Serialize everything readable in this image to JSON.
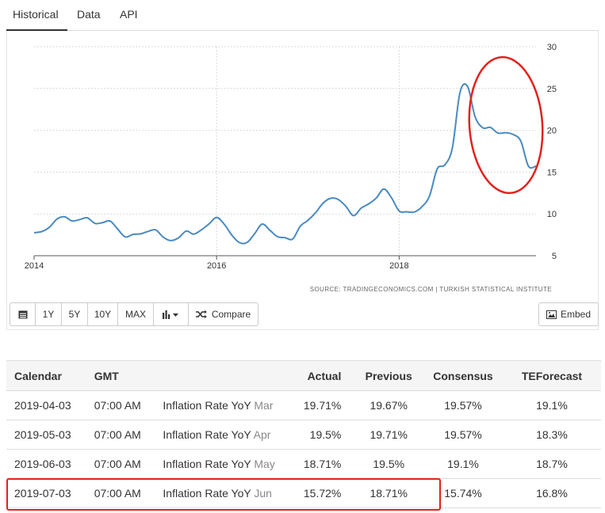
{
  "tabs": [
    "Historical",
    "Data",
    "API"
  ],
  "chart_data": {
    "type": "line",
    "x_ticks": [
      "2014",
      "2016",
      "2018"
    ],
    "y_ticks": [
      5,
      10,
      15,
      20,
      25,
      30
    ],
    "ylim": [
      5,
      30
    ],
    "xlim": [
      2014.0,
      2019.5
    ],
    "grid": true,
    "source_text": "SOURCE: TRADINGECONOMICS.COM  |  TURKISH STATISTICAL INSTITUTE",
    "series": [
      {
        "color": "#4a8ac0",
        "x": [
          2014.0,
          2014.083,
          2014.167,
          2014.25,
          2014.333,
          2014.417,
          2014.5,
          2014.583,
          2014.667,
          2014.75,
          2014.833,
          2014.917,
          2015.0,
          2015.083,
          2015.167,
          2015.25,
          2015.333,
          2015.417,
          2015.5,
          2015.583,
          2015.667,
          2015.75,
          2015.833,
          2015.917,
          2016.0,
          2016.083,
          2016.167,
          2016.25,
          2016.333,
          2016.417,
          2016.5,
          2016.583,
          2016.667,
          2016.75,
          2016.833,
          2016.917,
          2017.0,
          2017.083,
          2017.167,
          2017.25,
          2017.333,
          2017.417,
          2017.5,
          2017.583,
          2017.667,
          2017.75,
          2017.833,
          2017.917,
          2018.0,
          2018.083,
          2018.167,
          2018.25,
          2018.333,
          2018.417,
          2018.5,
          2018.583,
          2018.667,
          2018.75,
          2018.833,
          2018.917,
          2019.0,
          2019.083,
          2019.167,
          2019.25,
          2019.333,
          2019.417,
          2019.5
        ],
        "values": [
          7.75,
          7.89,
          8.39,
          9.38,
          9.66,
          9.16,
          9.32,
          9.54,
          8.86,
          8.96,
          9.15,
          8.17,
          7.24,
          7.55,
          7.61,
          7.91,
          8.09,
          7.2,
          6.81,
          7.14,
          7.95,
          7.58,
          8.1,
          8.81,
          9.58,
          8.78,
          7.46,
          6.57,
          6.58,
          7.64,
          8.79,
          8.05,
          7.28,
          7.16,
          7.0,
          8.53,
          9.22,
          10.13,
          11.29,
          11.87,
          11.72,
          10.9,
          9.79,
          10.68,
          11.2,
          11.9,
          12.98,
          11.92,
          10.35,
          10.26,
          10.23,
          10.85,
          12.15,
          15.39,
          15.85,
          17.9,
          24.52,
          25.24,
          21.62,
          20.3,
          20.35,
          19.67,
          19.71,
          19.5,
          18.71,
          15.72,
          15.72
        ]
      }
    ]
  },
  "toolbar": {
    "calendar_icon": "calendar-icon",
    "ranges": [
      "1Y",
      "5Y",
      "10Y",
      "MAX"
    ],
    "chart_type_icon": "bar-chart-icon",
    "compare_label": "Compare",
    "embed_label": "Embed"
  },
  "table": {
    "headers": [
      "Calendar",
      "GMT",
      "",
      "Actual",
      "Previous",
      "Consensus",
      "TEForecast"
    ],
    "rows": [
      {
        "date": "2019-04-03",
        "time": "07:00 AM",
        "event": "Inflation Rate YoY",
        "suffix": "Mar",
        "actual": "19.71%",
        "previous": "19.67%",
        "consensus": "19.57%",
        "forecast": "19.1%"
      },
      {
        "date": "2019-05-03",
        "time": "07:00 AM",
        "event": "Inflation Rate YoY",
        "suffix": "Apr",
        "actual": "19.5%",
        "previous": "19.71%",
        "consensus": "19.57%",
        "forecast": "18.3%"
      },
      {
        "date": "2019-06-03",
        "time": "07:00 AM",
        "event": "Inflation Rate YoY",
        "suffix": "May",
        "actual": "18.71%",
        "previous": "19.5%",
        "consensus": "19.1%",
        "forecast": "18.7%"
      },
      {
        "date": "2019-07-03",
        "time": "07:00 AM",
        "event": "Inflation Rate YoY",
        "suffix": "Jun",
        "actual": "15.72%",
        "previous": "18.71%",
        "consensus": "15.74%",
        "forecast": "16.8%"
      }
    ]
  },
  "highlight_color": "#e3211c"
}
